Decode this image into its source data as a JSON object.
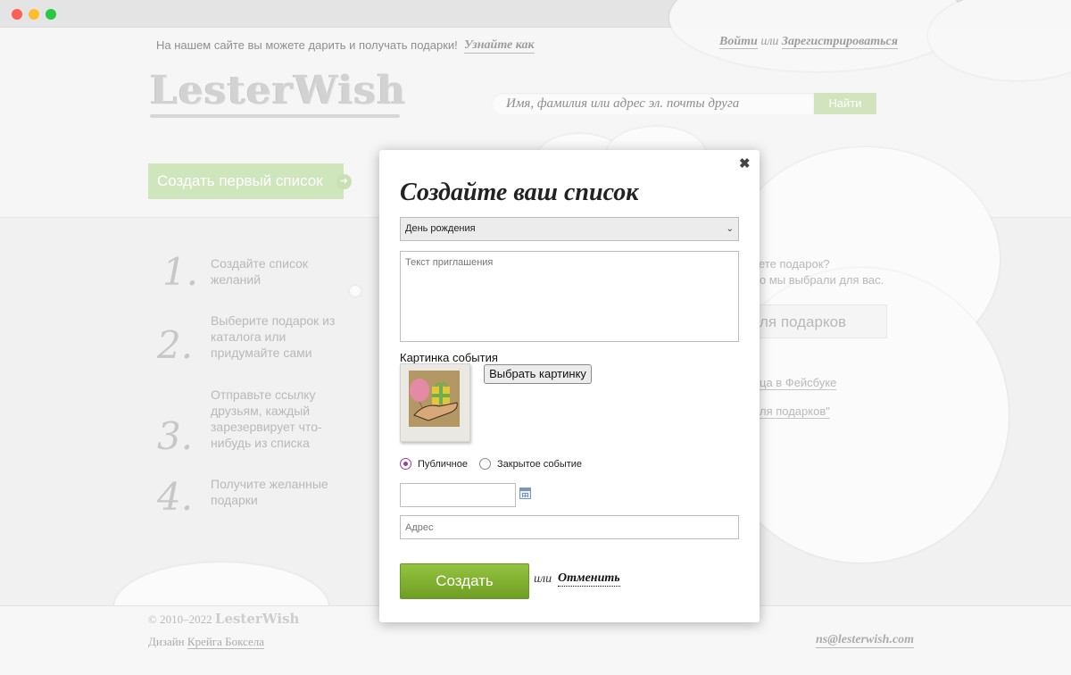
{
  "header": {
    "tagline": "На нашем сайте вы можете дарить и получать подарки!",
    "learn_link": "Узнайте как",
    "login": "Войти",
    "or": "или",
    "register": "Зарегистрироваться"
  },
  "logo": {
    "text": "LesterWish"
  },
  "search": {
    "placeholder": "Имя, фамилия или адрес эл. почты друга",
    "button": "Найти"
  },
  "first_list_button": "Создать первый список",
  "steps": [
    {
      "number": "1.",
      "text": "Создайте список желаний"
    },
    {
      "number": "2.",
      "text": "Выберите подарок из каталога или придумайте сами"
    },
    {
      "number": "3.",
      "text": "Отправьте ссылку друзьям, каждый зарезервирует что-нибудь из списка"
    },
    {
      "number": "4.",
      "text": "Получите желанные подарки"
    }
  ],
  "right_panel": {
    "line1": "ете подарок?",
    "line2": "о мы выбрали для вас.",
    "button": "ля подарков",
    "link1": "ца в Фейсбуке",
    "link2": "ля подарков\""
  },
  "footer": {
    "copyright": "© 2010–2022",
    "brand": "LesterWish",
    "design_prefix": "Дизайн",
    "designer": "Крейга Боксела",
    "email": "ns@lesterwish.com"
  },
  "modal": {
    "close": "✖",
    "title": "Создайте ваш список",
    "event_type": "День рождения",
    "invite_placeholder": "Текст приглашения",
    "picture_label": "Картинка события",
    "choose_picture": "Выбрать картинку",
    "radio_public": "Публичное",
    "radio_private": "Закрытое событие",
    "public_selected": true,
    "address_placeholder": "Адрес",
    "create": "Создать",
    "or": "или",
    "cancel": "Отменить"
  },
  "icons": {
    "close": "close-icon",
    "calendar": "calendar-icon",
    "arrow": "arrow-right-icon",
    "chevron": "chevron-down-icon"
  },
  "colors": {
    "accent_green": "#7fad2f",
    "radio_purple": "#9b3f9e",
    "light_green": "#c5e0ae"
  }
}
